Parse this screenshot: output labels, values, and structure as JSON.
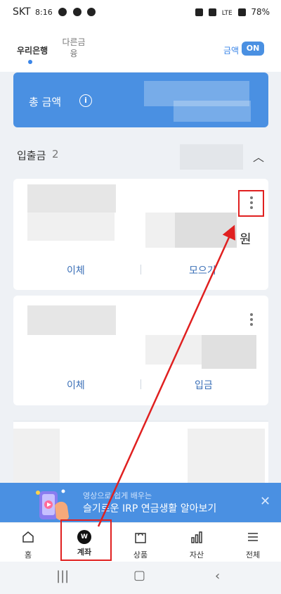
{
  "status_bar": {
    "carrier": "SKT",
    "time": "8:16",
    "right_text": "LTE",
    "battery": "78%"
  },
  "header": {
    "tabs": [
      "우리은행",
      "다른금융"
    ],
    "amount_label": "금액",
    "amount_toggle": "ON"
  },
  "total": {
    "label": "총 금액",
    "info_icon": "i"
  },
  "section": {
    "title": "입출금",
    "count": "2"
  },
  "account_cards": [
    {
      "won": "원",
      "actions": [
        "이체",
        "모으기"
      ]
    },
    {
      "won": "",
      "actions": [
        "이체",
        "입금"
      ]
    }
  ],
  "promo": {
    "small_text": "영상으로 쉽게 배우는",
    "big_text": "슬기로운 IRP 연금생활 알아보기",
    "close_icon": "close-icon"
  },
  "bottom_nav": [
    {
      "label": "홈",
      "icon": "home-icon"
    },
    {
      "label": "계좌",
      "icon": "account-icon",
      "badge": "W"
    },
    {
      "label": "상품",
      "icon": "shopping-bag-icon"
    },
    {
      "label": "자산",
      "icon": "bar-chart-icon"
    },
    {
      "label": "전체",
      "icon": "menu-icon"
    }
  ],
  "colors": {
    "primary": "#4a90e2",
    "link": "#3a6fb7",
    "highlight": "#e02020"
  }
}
